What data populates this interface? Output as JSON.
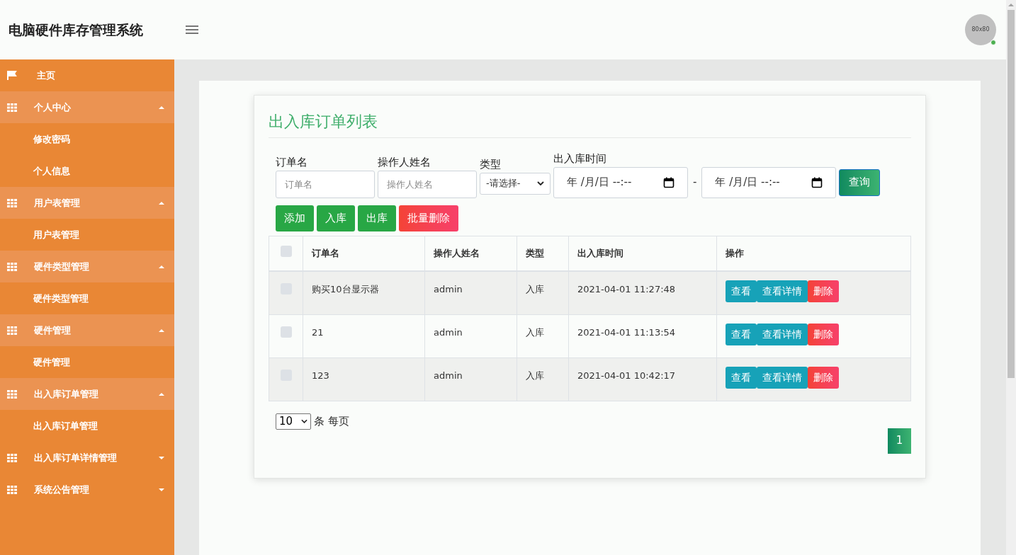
{
  "header": {
    "title": "电脑硬件库存管理系统",
    "avatar": "80x80",
    "online": true
  },
  "sidebar": {
    "items": [
      {
        "kind": "link",
        "label": "主页"
      },
      {
        "kind": "group",
        "label": "个人中心",
        "expanded": true,
        "children": [
          {
            "label": "修改密码"
          },
          {
            "label": "个人信息"
          }
        ]
      },
      {
        "kind": "group",
        "label": "用户表管理",
        "expanded": true,
        "children": [
          {
            "label": "用户表管理"
          }
        ]
      },
      {
        "kind": "group",
        "label": "硬件类型管理",
        "expanded": true,
        "children": [
          {
            "label": "硬件类型管理"
          }
        ]
      },
      {
        "kind": "group",
        "label": "硬件管理",
        "expanded": true,
        "children": [
          {
            "label": "硬件管理"
          }
        ]
      },
      {
        "kind": "group",
        "label": "出入库订单管理",
        "expanded": true,
        "children": [
          {
            "label": "出入库订单管理"
          }
        ]
      },
      {
        "kind": "group",
        "label": "出入库订单详情管理",
        "expanded": false
      },
      {
        "kind": "group",
        "label": "系统公告管理",
        "expanded": false
      }
    ]
  },
  "card": {
    "title": "出入库订单列表",
    "filters": [
      {
        "kind": "text",
        "label": "订单名",
        "placeholder": "订单名"
      },
      {
        "kind": "text",
        "label": "操作人姓名",
        "placeholder": "操作人姓名"
      },
      {
        "kind": "select",
        "label": "类型",
        "value": "-请选择-"
      },
      {
        "kind": "daterange",
        "label": "出入库时间",
        "from": "年 /月/日 --:--",
        "separator": "-",
        "to": "年 /月/日 --:--"
      }
    ],
    "search_button": "查询",
    "actions": [
      {
        "label": "添加",
        "kind": "success"
      },
      {
        "label": "入库",
        "kind": "success"
      },
      {
        "label": "出库",
        "kind": "success"
      },
      {
        "label": "批量删除",
        "kind": "danger"
      }
    ],
    "table": {
      "columns": [
        "订单名",
        "操作人姓名",
        "类型",
        "出入库时间",
        "操作"
      ],
      "all_checked": false,
      "rows": [
        {
          "checked": false,
          "cells": [
            "购买10台显示器",
            "admin",
            "入库",
            "2021-04-01 11:27:48"
          ],
          "buttons": [
            {
              "label": "查看",
              "kind": "info"
            },
            {
              "label": "查看详情",
              "kind": "info"
            },
            {
              "label": "删除",
              "kind": "danger"
            }
          ]
        },
        {
          "checked": false,
          "cells": [
            "21",
            "admin",
            "入库",
            "2021-04-01 11:13:54"
          ],
          "buttons": [
            {
              "label": "查看",
              "kind": "info"
            },
            {
              "label": "查看详情",
              "kind": "info"
            },
            {
              "label": "删除",
              "kind": "danger"
            }
          ]
        },
        {
          "checked": false,
          "cells": [
            "123",
            "admin",
            "入库",
            "2021-04-01 10:42:17"
          ],
          "buttons": [
            {
              "label": "查看",
              "kind": "info"
            },
            {
              "label": "查看详情",
              "kind": "info"
            },
            {
              "label": "删除",
              "kind": "danger"
            }
          ]
        }
      ]
    },
    "page_size": "10",
    "page_size_label": "条 每页",
    "pages": [
      {
        "label": "1",
        "selected": true
      }
    ]
  }
}
